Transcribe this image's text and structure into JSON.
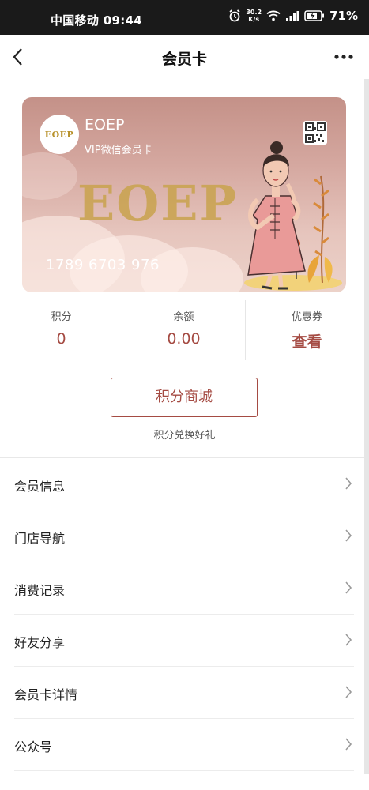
{
  "status_bar": {
    "carrier_time": "中国移动 09:44",
    "speed_value": "30.2",
    "speed_unit": "K/s",
    "battery": "71%"
  },
  "nav": {
    "title": "会员卡"
  },
  "card": {
    "brand": "EOEP",
    "logo_text": "EOEP",
    "subtitle": "VIP微信会员卡",
    "big_text": "EOEP",
    "number": "1789 6703 976"
  },
  "stats": [
    {
      "label": "积分",
      "value": "0"
    },
    {
      "label": "余额",
      "value": "0.00"
    },
    {
      "label": "优惠券",
      "value": "查看"
    }
  ],
  "mall": {
    "button": "积分商城",
    "subtitle": "积分兑换好礼"
  },
  "menu": [
    {
      "label": "会员信息"
    },
    {
      "label": "门店导航"
    },
    {
      "label": "消费记录"
    },
    {
      "label": "好友分享"
    },
    {
      "label": "会员卡详情"
    },
    {
      "label": "公众号"
    }
  ],
  "colors": {
    "accent": "#a54b43",
    "card_top": "#c49188",
    "card_bottom": "#ecd2c9",
    "gold": "#caa453"
  },
  "icons": [
    "alarm-icon",
    "wifi-icon",
    "signal-icon",
    "battery-icon",
    "back-arrow-icon",
    "more-icon",
    "qr-code-icon",
    "chevron-right-icon"
  ]
}
